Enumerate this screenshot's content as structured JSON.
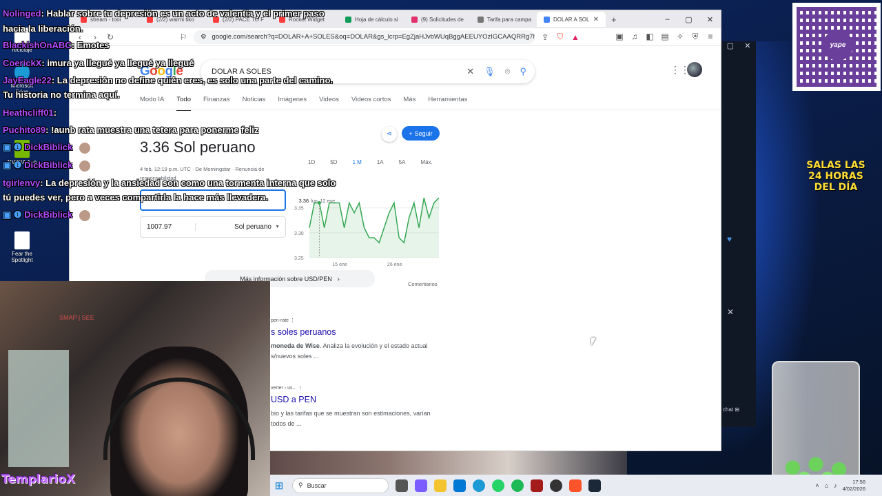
{
  "browser": {
    "tabs": [
      {
        "label": "stream - tooi",
        "color": "#ff3b3b"
      },
      {
        "label": "(2/2) warmi tiko",
        "color": "#ff3b3b"
      },
      {
        "label": "(2/2) PACE TO F",
        "color": "#ff3b3b"
      },
      {
        "label": "Rocket Widget",
        "color": "#ff3b3b"
      },
      {
        "label": "Hoja de cálculo si",
        "color": "#0f9d58"
      },
      {
        "label": "(9) Solicitudes de",
        "color": "#e1306c"
      },
      {
        "label": "Tarifa para campa",
        "color": "#777777"
      },
      {
        "label": "DOLAR A SOL",
        "color": "#4285f4",
        "active": true
      }
    ],
    "url": "google.com/search?q=DOLAR+A+SOLES&oq=DOLAR&gs_lcrp=EgZjaHJvbWUqBggAEEUYOzIGCAAQRRg7Mg..."
  },
  "google": {
    "logo_letters": [
      "G",
      "o",
      "o",
      "g",
      "l",
      "e"
    ],
    "query": "DOLAR A SOLES",
    "tabs": [
      "Modo IA",
      "Todo",
      "Finanzas",
      "Noticias",
      "Imágenes",
      "Videos",
      "Videos cortos",
      "Más",
      "Herramientas"
    ],
    "active_tab": "Todo"
  },
  "currency": {
    "value": "3.36 Sol peruano",
    "meta": "4 feb, 12:19 p.m. UTC · De Morningstar · Renuncia de responsabilidad",
    "follow": "Seguir",
    "ranges": [
      "1D",
      "5D",
      "1 M",
      "1A",
      "5A",
      "Máx."
    ],
    "selected_range": "1 M",
    "amount": "1007.97",
    "currency_name": "Sol peruano",
    "more_info": "Más información sobre USD/PEN",
    "comments": "Comentarios",
    "tooltip_value": "3.36",
    "tooltip_date": "lun, 12 ene"
  },
  "chart_data": {
    "type": "line",
    "series": [
      {
        "values": [
          3.31,
          3.36,
          3.36,
          3.31,
          3.36,
          3.36,
          3.36,
          3.31,
          3.36,
          3.34,
          3.36,
          3.31,
          3.29,
          3.29,
          3.28,
          3.31,
          3.34,
          3.36,
          3.29,
          3.28,
          3.33,
          3.36,
          3.31,
          3.37,
          3.33,
          3.36,
          3.37
        ]
      }
    ],
    "yticks": [
      "3.35",
      "3.30",
      "3.25"
    ],
    "ylim": [
      3.25,
      3.38
    ],
    "xticks": [
      "15 ene",
      "26 ene"
    ],
    "line_color": "#34a853"
  },
  "results": [
    {
      "crumb": "pen-rate",
      "title": "s soles peruanos",
      "snippet_bold": "moneda de Wise",
      "snippet": ". Analiza la evolución y el estado actual",
      "snippet2": "s/nuevos soles ..."
    },
    {
      "crumb": "verter › us...",
      "title": "USD a PEN",
      "snippet": "bio y las tarifas que se muestran son estimaciones, varían",
      "snippet2": "todos de ..."
    }
  ],
  "chat": [
    {
      "user": "Nolinged",
      "msg": ": Hablar sobre tu depresión es un acto de valentía y el primer paso"
    },
    {
      "user": "",
      "msg": "hacia la liberación."
    },
    {
      "user": "BlackishOnABC",
      "msg": ": Emotes"
    },
    {
      "user": "CoerickX",
      "msg": ": imura ya llegué ya llegué ya llegué"
    },
    {
      "user": "JayEagle22",
      "msg": ": La depresión no define quién eres, es solo una parte del camino."
    },
    {
      "user": "",
      "msg": "Tu historia no termina aquí."
    },
    {
      "user": "Heathcliff01",
      "msg": ":"
    },
    {
      "user": "Puchito89",
      "msg": ": !aunb rata muestra una tetera para ponerme feliz"
    },
    {
      "user": "DickBiblick",
      "msg": ""
    },
    {
      "user": "DickBiblick",
      "msg": ""
    },
    {
      "user": "tgirlenvy",
      "msg": ": La depresión y la ansiedad son como una tormenta interna que solo"
    },
    {
      "user": "",
      "msg": "tú puedes ver, pero a veces compartirla la hace más llevadera."
    },
    {
      "user": "DickBiblick",
      "msg": ""
    }
  ],
  "desktop_icons": [
    "reciclaje",
    "Microsoft Edge",
    "Roblox S",
    "NVIDIA App",
    "Launc",
    "Fear the Spotlight"
  ],
  "overlays": {
    "yape": "yape",
    "salas": "SALAS LAS 24 HORAS DEL DÍA",
    "templario": "TemplarioX",
    "webcam_text": "SMAP | SEE"
  },
  "taskbar": {
    "search_placeholder": "Buscar",
    "time": "17:56",
    "date": "4/02/2026"
  },
  "side_panel": {
    "chat_label": "chat"
  }
}
